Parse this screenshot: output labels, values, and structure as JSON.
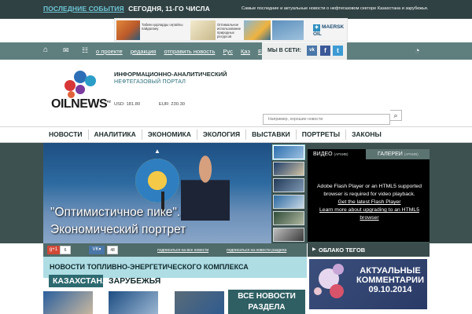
{
  "topbar": {
    "events_link": "ПОСЛЕДНИЕ СОБЫТИЯ",
    "date_text": "СЕГОДНЯ, 11-ГО ЧИСЛА",
    "tagline": "Самые последние и актуальные новости о нефтегазовом секторе Казахстана и зарубежья."
  },
  "banner": {
    "text1": "Табиғи қорларды оңтайлы пайдалану",
    "text2": "Оптимальное использование природных ресурсов",
    "brand": "MAERSK OIL"
  },
  "utilbar": {
    "links": [
      "о проекте",
      "редакция",
      "отправить новость",
      "Рус",
      "Қаз",
      "Eng"
    ],
    "social_label": "МЫ В СЕТИ:",
    "icons": [
      "home-icon",
      "mail-icon",
      "sitemap-icon",
      "vk-icon",
      "facebook-icon",
      "twitter-icon",
      "rss-icon"
    ]
  },
  "logo": {
    "name": "OILNEWS",
    "sup": "KZ",
    "subtitle1": "ИНФОРМАЦИОННО-АНАЛИТИЧЕСКИЙ",
    "subtitle2": "НЕФТЕГАЗОВЫЙ ПОРТАЛ"
  },
  "currency": {
    "usd": "USD: 181.80",
    "eur": "EUR: 230.30"
  },
  "search": {
    "placeholder": "Например, хорошие новости"
  },
  "mainnav": [
    "НОВОСТИ",
    "АНАЛИТИКА",
    "ЭКОНОМИКА",
    "ЭКОЛОГИЯ",
    "ВЫСТАВКИ",
    "ПОРТРЕТЫ",
    "ЗАКОНЫ"
  ],
  "hero": {
    "caption": "\"Оптимистичное пике\". Экономический портрет"
  },
  "video": {
    "tab_video": "ВИДЕО",
    "tab_video_archive": "(АРХИВ)",
    "tab_gallery": "ГАЛЕРЕИ",
    "tab_gallery_archive": "(АРХИВ)",
    "msg1": "Adobe Flash Player or an HTML5 supported browser is required for video playback.",
    "msg2": "Get the latest Flash Player",
    "msg3": "Learn more about upgrading to an HTML5 browser"
  },
  "share": {
    "gplus": "g+1",
    "gplus_count": "6",
    "vk": "VK",
    "vk_count": "48",
    "sub_all": "подписаться на все новости",
    "sub_section": "подписаться на новости раздела"
  },
  "section": {
    "title": "НОВОСТИ ТОПЛИВНО-ЭНЕРГЕТИЧЕСКОГО КОМПЛЕКСА",
    "tab_kz": "КАЗАХСТАНА",
    "tab_abroad": "ЗАРУБЕЖЬЯ",
    "all_news": "ВСЕ НОВОСТИ РАЗДЕЛА"
  },
  "tagcloud": {
    "title": "ОБЛАКО ТЕГОВ"
  },
  "promo": {
    "text": "АКТУАЛЬНЫЕ КОММЕНТАРИИ 09.10.2014"
  },
  "colors": {
    "topbar": "#2f4143",
    "teal": "#5f7f7f",
    "accent": "#6fc6d6",
    "band": "#3d5250"
  }
}
